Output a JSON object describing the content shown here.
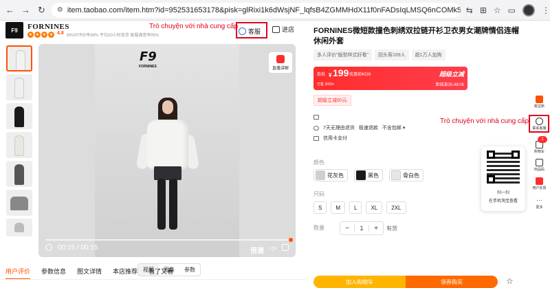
{
  "browser": {
    "url": "item.taobao.com/item.htm?id=952531653178&pisk=glRixi1k6dWsjNF_lqfsB4ZGMMHdX11f0nFADsIqLMSQ6nCOMk5FuaeN7ZywKZ-vAqg16ES..."
  },
  "shop": {
    "logo_text": "FORNINES",
    "name": "FORNINES",
    "score": "4.8",
    "stats": "88VIP评价率98%  平均20小时发货  客服满意率95%",
    "service_label": "客服",
    "enter_shop_label": "进店"
  },
  "annotations": {
    "chat_top": "Trò chuyện với nhà cung cấp",
    "chat_side": "Trò chuyện với nhà cung cấp"
  },
  "video": {
    "brand_sub": "FORNINES",
    "live_label": "直播讲解",
    "time": "00:15 / 00:15",
    "speed_label": "倍速"
  },
  "media_tabs": [
    "视频",
    "图集",
    "参数"
  ],
  "bottom_tabs": [
    "用户评价",
    "参数信息",
    "图文详情",
    "本店推荐",
    "看了又看"
  ],
  "product": {
    "title": "FORNINES微短款撞色刺绣双拉链开衫卫衣男女潮牌情侣连帽休闲外套",
    "tags": [
      "多人评价\"版型样式好看\"",
      "回头客169人",
      "超1万人加购"
    ],
    "price_label": "券后",
    "price_symbol": "¥",
    "price": "199",
    "original_price": "优惠前¥239",
    "sold": "已售 3000+",
    "flash_label": "超级立减",
    "countdown": "距结束35:48:06",
    "coupon": "超级立减60元",
    "shipping": "",
    "services": [
      "7天无理由退货",
      "极速退款",
      "不含包邮 ▾"
    ],
    "credit": "信用卡支付",
    "color_label": "颜色",
    "colors": [
      {
        "name": "花灰色",
        "swatch": "#cfcfcf"
      },
      {
        "name": "黑色",
        "swatch": "#1a1a1a"
      },
      {
        "name": "骨白色",
        "swatch": "#e9e7e1"
      }
    ],
    "size_label": "尺码",
    "sizes": [
      "S",
      "M",
      "L",
      "XL",
      "2XL"
    ],
    "qty_label": "数量",
    "qty_minus": "−",
    "qty": "1",
    "qty_plus": "+",
    "stock": "有货",
    "cart_label": "加入购物车",
    "buy_label": "领券购买"
  },
  "sidebar": {
    "items": [
      "桃宝新",
      "联系客服",
      "购物车",
      "商品码",
      "用户反馈",
      "更多"
    ],
    "cart_badge": "1",
    "qr_line1": "扫一扫",
    "qr_line2": "在手机淘宝查看"
  },
  "colors": {
    "accent": "#ff5000",
    "price_red": "#ff2d2d",
    "annotation_red": "#e0001b"
  }
}
